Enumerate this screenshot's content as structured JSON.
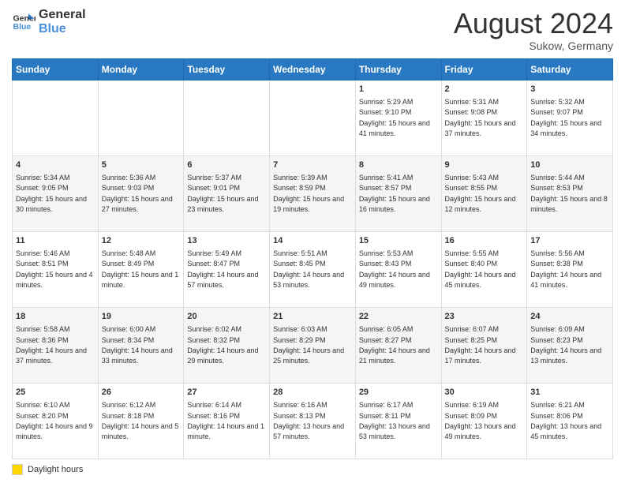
{
  "logo": {
    "line1": "General",
    "line2": "Blue"
  },
  "header": {
    "month_year": "August 2024",
    "location": "Sukow, Germany"
  },
  "weekdays": [
    "Sunday",
    "Monday",
    "Tuesday",
    "Wednesday",
    "Thursday",
    "Friday",
    "Saturday"
  ],
  "weeks": [
    [
      {
        "day": "",
        "text": ""
      },
      {
        "day": "",
        "text": ""
      },
      {
        "day": "",
        "text": ""
      },
      {
        "day": "",
        "text": ""
      },
      {
        "day": "1",
        "text": "Sunrise: 5:29 AM\nSunset: 9:10 PM\nDaylight: 15 hours and 41 minutes."
      },
      {
        "day": "2",
        "text": "Sunrise: 5:31 AM\nSunset: 9:08 PM\nDaylight: 15 hours and 37 minutes."
      },
      {
        "day": "3",
        "text": "Sunrise: 5:32 AM\nSunset: 9:07 PM\nDaylight: 15 hours and 34 minutes."
      }
    ],
    [
      {
        "day": "4",
        "text": "Sunrise: 5:34 AM\nSunset: 9:05 PM\nDaylight: 15 hours and 30 minutes."
      },
      {
        "day": "5",
        "text": "Sunrise: 5:36 AM\nSunset: 9:03 PM\nDaylight: 15 hours and 27 minutes."
      },
      {
        "day": "6",
        "text": "Sunrise: 5:37 AM\nSunset: 9:01 PM\nDaylight: 15 hours and 23 minutes."
      },
      {
        "day": "7",
        "text": "Sunrise: 5:39 AM\nSunset: 8:59 PM\nDaylight: 15 hours and 19 minutes."
      },
      {
        "day": "8",
        "text": "Sunrise: 5:41 AM\nSunset: 8:57 PM\nDaylight: 15 hours and 16 minutes."
      },
      {
        "day": "9",
        "text": "Sunrise: 5:43 AM\nSunset: 8:55 PM\nDaylight: 15 hours and 12 minutes."
      },
      {
        "day": "10",
        "text": "Sunrise: 5:44 AM\nSunset: 8:53 PM\nDaylight: 15 hours and 8 minutes."
      }
    ],
    [
      {
        "day": "11",
        "text": "Sunrise: 5:46 AM\nSunset: 8:51 PM\nDaylight: 15 hours and 4 minutes."
      },
      {
        "day": "12",
        "text": "Sunrise: 5:48 AM\nSunset: 8:49 PM\nDaylight: 15 hours and 1 minute."
      },
      {
        "day": "13",
        "text": "Sunrise: 5:49 AM\nSunset: 8:47 PM\nDaylight: 14 hours and 57 minutes."
      },
      {
        "day": "14",
        "text": "Sunrise: 5:51 AM\nSunset: 8:45 PM\nDaylight: 14 hours and 53 minutes."
      },
      {
        "day": "15",
        "text": "Sunrise: 5:53 AM\nSunset: 8:43 PM\nDaylight: 14 hours and 49 minutes."
      },
      {
        "day": "16",
        "text": "Sunrise: 5:55 AM\nSunset: 8:40 PM\nDaylight: 14 hours and 45 minutes."
      },
      {
        "day": "17",
        "text": "Sunrise: 5:56 AM\nSunset: 8:38 PM\nDaylight: 14 hours and 41 minutes."
      }
    ],
    [
      {
        "day": "18",
        "text": "Sunrise: 5:58 AM\nSunset: 8:36 PM\nDaylight: 14 hours and 37 minutes."
      },
      {
        "day": "19",
        "text": "Sunrise: 6:00 AM\nSunset: 8:34 PM\nDaylight: 14 hours and 33 minutes."
      },
      {
        "day": "20",
        "text": "Sunrise: 6:02 AM\nSunset: 8:32 PM\nDaylight: 14 hours and 29 minutes."
      },
      {
        "day": "21",
        "text": "Sunrise: 6:03 AM\nSunset: 8:29 PM\nDaylight: 14 hours and 25 minutes."
      },
      {
        "day": "22",
        "text": "Sunrise: 6:05 AM\nSunset: 8:27 PM\nDaylight: 14 hours and 21 minutes."
      },
      {
        "day": "23",
        "text": "Sunrise: 6:07 AM\nSunset: 8:25 PM\nDaylight: 14 hours and 17 minutes."
      },
      {
        "day": "24",
        "text": "Sunrise: 6:09 AM\nSunset: 8:23 PM\nDaylight: 14 hours and 13 minutes."
      }
    ],
    [
      {
        "day": "25",
        "text": "Sunrise: 6:10 AM\nSunset: 8:20 PM\nDaylight: 14 hours and 9 minutes."
      },
      {
        "day": "26",
        "text": "Sunrise: 6:12 AM\nSunset: 8:18 PM\nDaylight: 14 hours and 5 minutes."
      },
      {
        "day": "27",
        "text": "Sunrise: 6:14 AM\nSunset: 8:16 PM\nDaylight: 14 hours and 1 minute."
      },
      {
        "day": "28",
        "text": "Sunrise: 6:16 AM\nSunset: 8:13 PM\nDaylight: 13 hours and 57 minutes."
      },
      {
        "day": "29",
        "text": "Sunrise: 6:17 AM\nSunset: 8:11 PM\nDaylight: 13 hours and 53 minutes."
      },
      {
        "day": "30",
        "text": "Sunrise: 6:19 AM\nSunset: 8:09 PM\nDaylight: 13 hours and 49 minutes."
      },
      {
        "day": "31",
        "text": "Sunrise: 6:21 AM\nSunset: 8:06 PM\nDaylight: 13 hours and 45 minutes."
      }
    ]
  ],
  "footer": {
    "daylight_label": "Daylight hours"
  }
}
